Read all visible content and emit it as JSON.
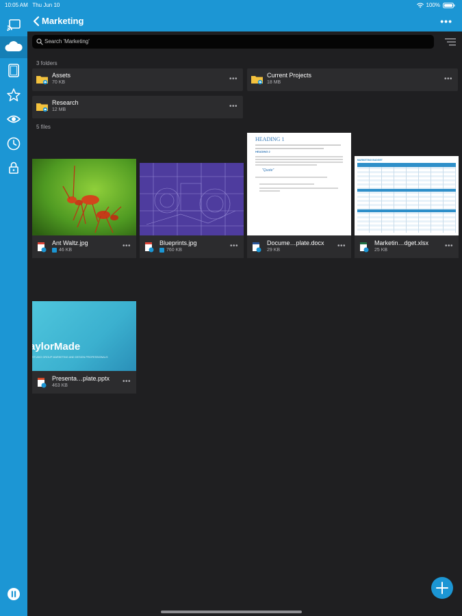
{
  "status_bar": {
    "time": "10:05 AM",
    "date": "Thu Jun 10",
    "battery": "100%"
  },
  "header": {
    "title": "Marketing"
  },
  "search": {
    "placeholder": "Search 'Marketing'"
  },
  "sections": {
    "folders_label": "3 folders",
    "files_label": "5 files"
  },
  "folders": [
    {
      "name": "Assets",
      "size": "70 KB"
    },
    {
      "name": "Current Projects",
      "size": "18 MB"
    },
    {
      "name": "Research",
      "size": "12 MB"
    }
  ],
  "files": [
    {
      "name": "Ant Waltz.jpg",
      "size": "46 KB",
      "synced": true
    },
    {
      "name": "Blueprints.jpg",
      "size": "760 KB",
      "synced": true
    },
    {
      "name": "Docume…plate.docx",
      "size": "29 KB",
      "synced": false
    },
    {
      "name": "Marketin…dget.xlsx",
      "size": "25 KB",
      "synced": false
    },
    {
      "name": "Presenta…plate.pptx",
      "size": "463 KB",
      "synced": false
    }
  ],
  "thumbnails": {
    "doc": {
      "heading1": "HEADING 1",
      "heading2": "HEADING 2",
      "quote": "\"Quote\""
    },
    "xlsx": {
      "title": "MARKETING BUDGET"
    },
    "pptx": {
      "title": "aylorMade",
      "subtitle": "STUDIO GROUP MARKETING AND DESIGN PROFESSIONALS"
    }
  },
  "colors": {
    "accent": "#1c96d4",
    "background": "#1f1f21",
    "card": "#2c2c2e",
    "folder": "#f4c23d"
  },
  "icons": [
    "cast-icon",
    "cloud-icon",
    "tablet-icon",
    "star-icon",
    "eye-icon",
    "clock-icon",
    "lock-icon",
    "pause-icon",
    "search-icon",
    "sort-icon",
    "folder-icon",
    "plus-icon"
  ]
}
